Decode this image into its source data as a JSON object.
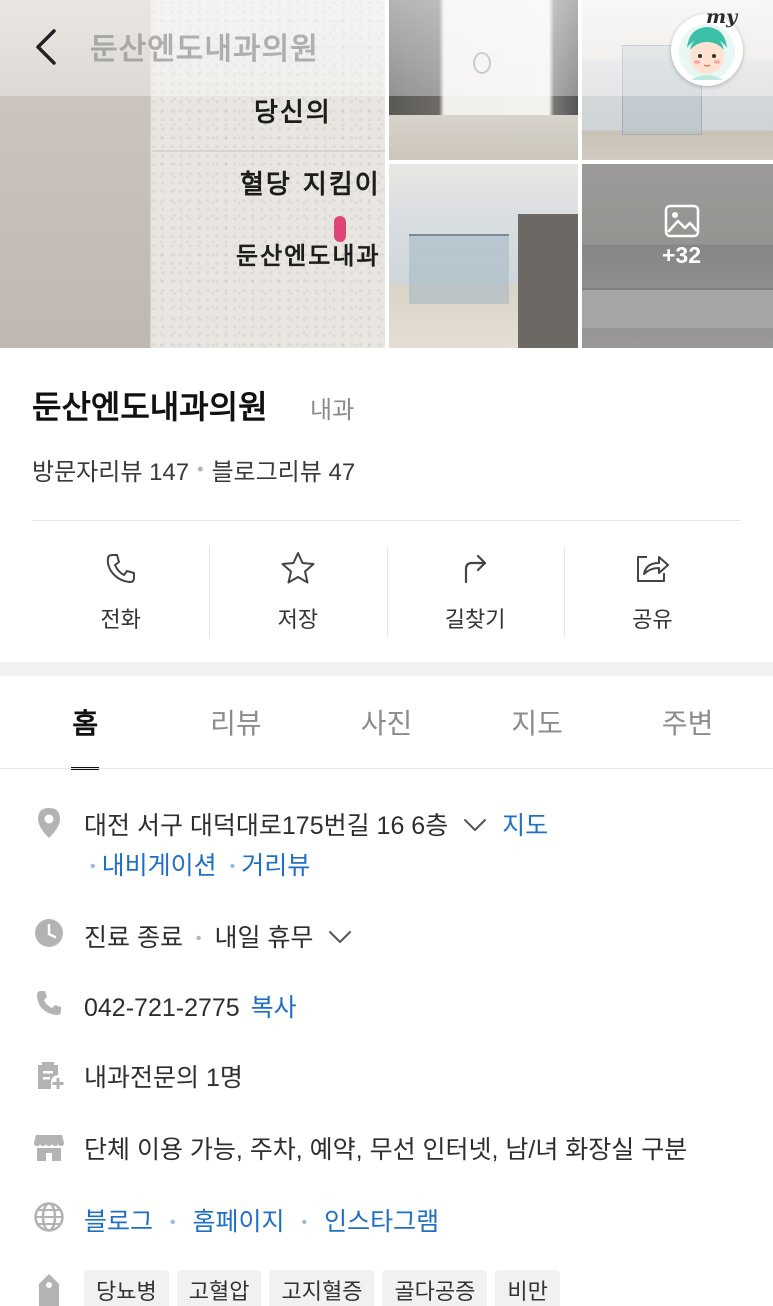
{
  "header": {
    "title": "둔산엔도내과의원",
    "my_label": "my",
    "back_icon": "chevron-left-icon"
  },
  "gallery": {
    "main_sign_lines": [
      "당신의",
      "혈당 지킴이",
      "둔산엔도내과"
    ],
    "more_count": "+32"
  },
  "place": {
    "name": "둔산엔도내과의원",
    "category": "내과",
    "visitor_reviews": "방문자리뷰 147",
    "blog_reviews": "블로그리뷰 47"
  },
  "actions": [
    {
      "label": "전화",
      "icon": "phone-icon"
    },
    {
      "label": "저장",
      "icon": "star-icon"
    },
    {
      "label": "길찾기",
      "icon": "directions-icon"
    },
    {
      "label": "공유",
      "icon": "share-icon"
    }
  ],
  "tabs": [
    {
      "label": "홈",
      "active": true
    },
    {
      "label": "리뷰",
      "active": false
    },
    {
      "label": "사진",
      "active": false
    },
    {
      "label": "지도",
      "active": false
    },
    {
      "label": "주변",
      "active": false
    }
  ],
  "info": {
    "address": "대전 서구 대덕대로175번길 16 6층",
    "map_link": "지도",
    "navigation_link": "내비게이션",
    "street_view_link": "거리뷰",
    "hours_status": "진료 종료",
    "hours_next": "내일 휴무",
    "phone": "042-721-2775",
    "copy_label": "복사",
    "specialists": "내과전문의 1명",
    "amenities": "단체 이용 가능, 주차, 예약, 무선 인터넷, 남/녀 화장실 구분",
    "links": [
      "블로그",
      "홈페이지",
      "인스타그램"
    ],
    "tags": [
      "당뇨병",
      "고혈압",
      "고지혈증",
      "골다공증",
      "비만"
    ]
  },
  "colors": {
    "link": "#1f6fc7",
    "icon_gray": "#b3b3b3",
    "text": "#2e2e2e",
    "band": "#f2f2f2"
  }
}
